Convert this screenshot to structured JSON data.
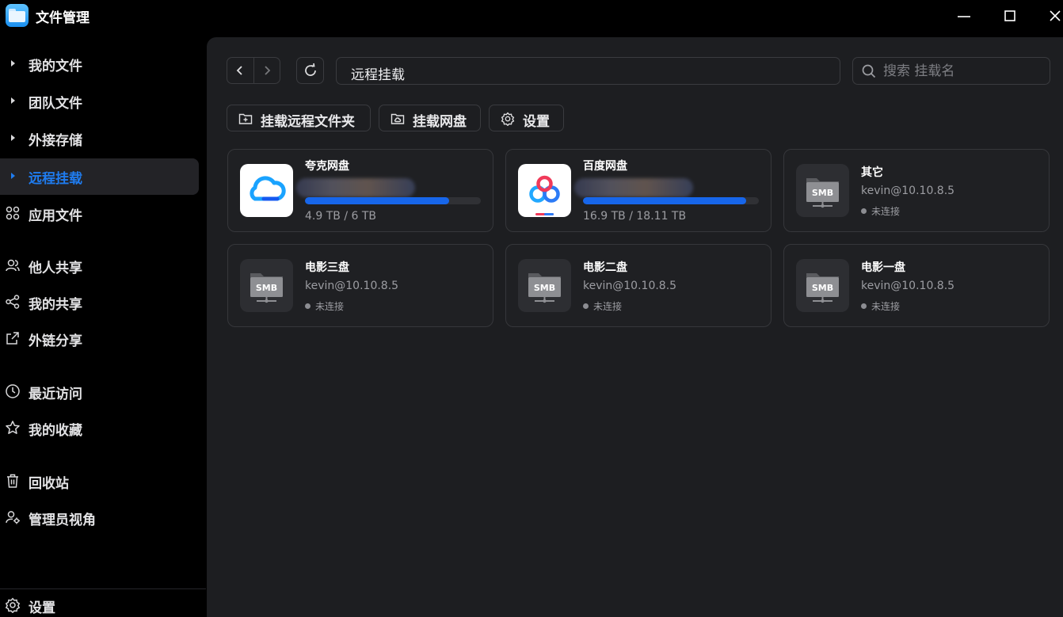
{
  "app": {
    "title": "文件管理"
  },
  "sidebar": {
    "items": [
      {
        "label": "我的文件",
        "icon": "triangle-right-icon"
      },
      {
        "label": "团队文件",
        "icon": "triangle-right-icon"
      },
      {
        "label": "外接存储",
        "icon": "triangle-right-icon"
      },
      {
        "label": "远程挂载",
        "icon": "triangle-right-icon",
        "active": true
      },
      {
        "label": "应用文件",
        "icon": "apps-grid-icon"
      },
      {
        "label": "他人共享",
        "icon": "users-icon"
      },
      {
        "label": "我的共享",
        "icon": "share-icon"
      },
      {
        "label": "外链分享",
        "icon": "external-share-icon"
      },
      {
        "label": "最近访问",
        "icon": "clock-icon"
      },
      {
        "label": "我的收藏",
        "icon": "star-icon"
      },
      {
        "label": "回收站",
        "icon": "trash-icon"
      },
      {
        "label": "管理员视角",
        "icon": "admin-user-icon"
      }
    ],
    "settings_label": "设置"
  },
  "toolbar": {
    "path": "远程挂载",
    "search_placeholder": "搜索 挂载名",
    "mount_folder_label": "挂载远程文件夹",
    "mount_disk_label": "挂载网盘",
    "settings_label": "设置"
  },
  "mounts": [
    {
      "name": "夸克网盘",
      "type": "quark-cloud",
      "usage_text": "4.9 TB / 6 TB",
      "used_fraction": 0.82
    },
    {
      "name": "百度网盘",
      "type": "baidu-cloud",
      "usage_text": "16.9 TB / 18.11 TB",
      "used_fraction": 0.93
    },
    {
      "name": "其它",
      "type": "smb",
      "icon_label": "SMB",
      "address": "kevin@10.10.8.5",
      "status": "未连接"
    },
    {
      "name": "电影三盘",
      "type": "smb",
      "icon_label": "SMB",
      "address": "kevin@10.10.8.5",
      "status": "未连接"
    },
    {
      "name": "电影二盘",
      "type": "smb",
      "icon_label": "SMB",
      "address": "kevin@10.10.8.5",
      "status": "未连接"
    },
    {
      "name": "电影一盘",
      "type": "smb",
      "icon_label": "SMB",
      "address": "kevin@10.10.8.5",
      "status": "未连接"
    }
  ],
  "colors": {
    "accent": "#1f7cf0",
    "progress": "#1766ea",
    "panel": "#1d1e21"
  }
}
